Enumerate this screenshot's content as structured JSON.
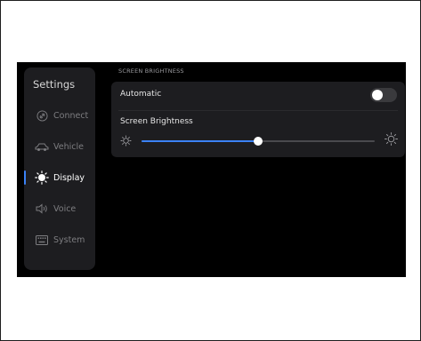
{
  "sidebar": {
    "title": "Settings",
    "items": [
      {
        "label": "Connect",
        "icon": "link-icon"
      },
      {
        "label": "Vehicle",
        "icon": "car-icon"
      },
      {
        "label": "Display",
        "icon": "sun-icon",
        "active": true
      },
      {
        "label": "Voice",
        "icon": "speaker-icon"
      },
      {
        "label": "System",
        "icon": "keyboard-icon"
      }
    ]
  },
  "main": {
    "section_label": "SCREEN BRIGHTNESS",
    "automatic_label": "Automatic",
    "automatic_on": false,
    "brightness_label": "Screen Brightness",
    "brightness_level": 0.5
  },
  "colors": {
    "accent": "#3b82f6",
    "screen_bg": "#000000",
    "panel_bg": "#1d1d20"
  }
}
